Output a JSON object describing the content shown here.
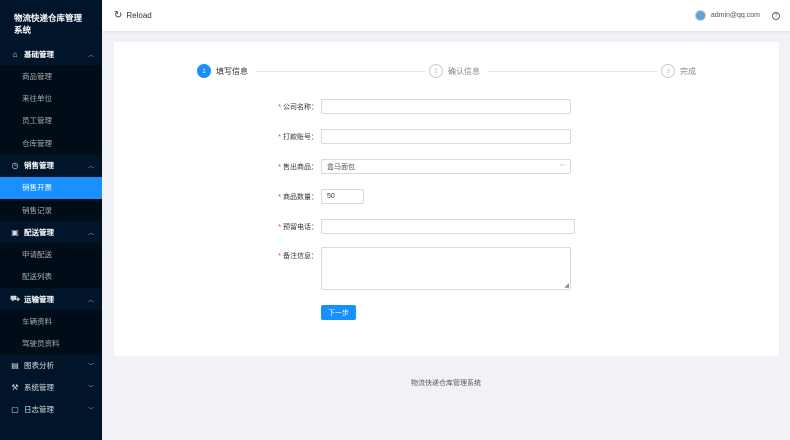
{
  "app": {
    "title": "物流快递仓库管理系统"
  },
  "sidebar": {
    "groups": [
      {
        "label": "基础管理",
        "icon": "home-icon",
        "items": [
          "商品管理",
          "来往单位",
          "员工管理",
          "仓库管理"
        ]
      },
      {
        "label": "销售管理",
        "icon": "clock-icon",
        "items": [
          "销售开票",
          "销售记录"
        ]
      },
      {
        "label": "配送管理",
        "icon": "truck-icon",
        "items": [
          "申请配送",
          "配送列表"
        ]
      },
      {
        "label": "运输管理",
        "icon": "transport-icon",
        "items": [
          "车辆资料",
          "驾驶员资料"
        ]
      },
      {
        "label": "图表分析",
        "icon": "chart-icon",
        "items": []
      },
      {
        "label": "系统管理",
        "icon": "tool-icon",
        "items": []
      },
      {
        "label": "日志管理",
        "icon": "log-icon",
        "items": []
      }
    ],
    "active_item": "销售开票"
  },
  "header": {
    "reload": "Reload",
    "user": "admin@qq.com",
    "help": "?"
  },
  "steps": [
    {
      "num": "1",
      "title": "填写信息"
    },
    {
      "num": "2",
      "title": "确认信息"
    },
    {
      "num": "3",
      "title": "完成"
    }
  ],
  "form": {
    "company_label": "公司名称",
    "account_label": "打款账号",
    "product_label": "售出商品",
    "product_value": "盒马面包",
    "qty_label": "商品数量",
    "qty_value": "50",
    "phone_label": "预留电话",
    "remark_label": "备注信息",
    "next_button": "下一步"
  },
  "footer": {
    "text": "物流快递仓库管理系统"
  },
  "colors": {
    "primary": "#1890ff",
    "sidebar_bg": "#001529"
  }
}
